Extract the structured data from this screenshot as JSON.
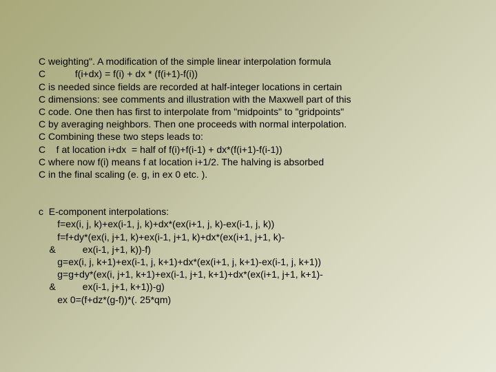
{
  "block1": {
    "l1": "C weighting\". A modification of the simple linear interpolation formula",
    "l2": "C           f(i+dx) = f(i) + dx * (f(i+1)-f(i))",
    "l3": "C is needed since fields are recorded at half-integer locations in certain",
    "l4": "C dimensions: see comments and illustration with the Maxwell part of this",
    "l5": "C code. One then has first to interpolate from \"midpoints\" to \"gridpoints\"",
    "l6": "C by averaging neighbors. Then one proceeds with normal interpolation.",
    "l7": "C Combining these two steps leads to:",
    "l8": "C    f at location i+dx  = half of f(i)+f(i-1) + dx*(f(i+1)-f(i-1))",
    "l9": "C where now f(i) means f at location i+1/2. The halving is absorbed",
    "l10": "C in the final scaling (e. g, in ex 0 etc. )."
  },
  "block2": {
    "l1": "c  E-component interpolations:",
    "l2": "       f=ex(i, j, k)+ex(i-1, j, k)+dx*(ex(i+1, j, k)-ex(i-1, j, k))",
    "l3": "       f=f+dy*(ex(i, j+1, k)+ex(i-1, j+1, k)+dx*(ex(i+1, j+1, k)-",
    "l4": "    &          ex(i-1, j+1, k))-f)",
    "l5": "       g=ex(i, j, k+1)+ex(i-1, j, k+1)+dx*(ex(i+1, j, k+1)-ex(i-1, j, k+1))",
    "l6": "       g=g+dy*(ex(i, j+1, k+1)+ex(i-1, j+1, k+1)+dx*(ex(i+1, j+1, k+1)-",
    "l7": "    &          ex(i-1, j+1, k+1))-g)",
    "l8": "       ex 0=(f+dz*(g-f))*(. 25*qm)"
  }
}
